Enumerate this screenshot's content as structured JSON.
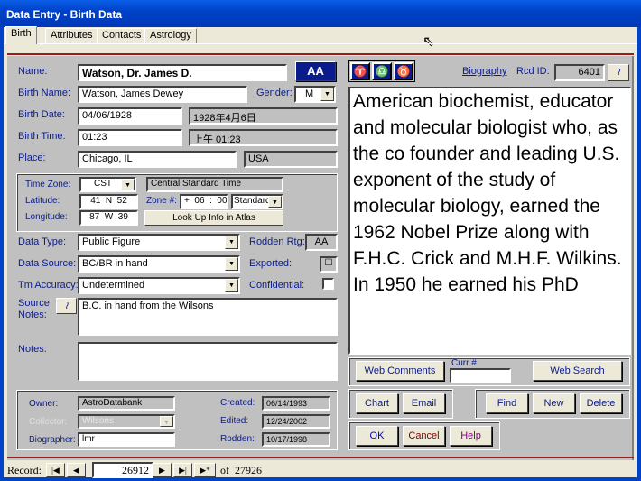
{
  "window": {
    "title": "Data Entry - Birth Data"
  },
  "tabs": [
    {
      "label": "Birth"
    },
    {
      "label": "Attributes"
    },
    {
      "label": "Contacts"
    },
    {
      "label": "Astrology"
    }
  ],
  "birth": {
    "name_label": "Name:",
    "name": "Watson, Dr. James D.",
    "aa_button": "AA",
    "birth_name_label": "Birth Name:",
    "birth_name": "Watson, James Dewey",
    "gender_label": "Gender:",
    "gender": "M",
    "birth_date_label": "Birth Date:",
    "birth_date": "04/06/1928",
    "birth_date_local": "1928年4月6日",
    "birth_time_label": "Birth Time:",
    "birth_time": "01:23",
    "birth_time_local": "上午 01:23",
    "place_label": "Place:",
    "place": "Chicago, IL",
    "country": "USA",
    "time_zone_label": "Time Zone:",
    "time_zone": "CST",
    "time_zone_name": "Central Standard Time",
    "latitude_label": "Latitude:",
    "latitude": "41  N  52",
    "zone_label": "Zone #:",
    "zone": "+  06  :  00",
    "zone_type": "Standard",
    "longitude_label": "Longitude:",
    "longitude": "87  W  39",
    "lookup_button": "Look Up Info in Atlas",
    "data_type_label": "Data Type:",
    "data_type": "Public Figure",
    "rodden_label": "Rodden Rtg:",
    "rodden": "AA",
    "data_source_label": "Data Source:",
    "data_source": "BC/BR in hand",
    "exported_label": "Exported:",
    "tm_accuracy_label": "Tm Accuracy:",
    "tm_accuracy": "Undetermined",
    "confidential_label": "Confidential:",
    "source_notes_label1": "Source",
    "source_notes_label2": "Notes:",
    "source_notes": "B.C. in hand from the Wilsons",
    "notes_label": "Notes:",
    "notes": "",
    "owner_label": "Owner:",
    "owner": "AstroDatabank",
    "collector_label": "Collector:",
    "collector": "Wilsons",
    "biographer_label": "Biographer:",
    "biographer": "lmr",
    "created_label": "Created:",
    "created": "06/14/1993",
    "edited_label": "Edited:",
    "edited": "12/24/2002",
    "rodden_date_label": "Rodden:",
    "rodden_date": "10/17/1998"
  },
  "right": {
    "symbols": [
      "♈",
      "♎",
      "♉"
    ],
    "biography_label": "Biography",
    "rcd_id_label": "Rcd ID:",
    "rcd_id": "6401",
    "biography": "American biochemist, educator and molecular biologist who, as the co founder and leading U.S. exponent of the study of molecular biology, earned the 1962 Nobel Prize along with F.H.C. Crick and M.H.F. Wilkins.  In 1950 he earned his PhD",
    "web_comments": "Web Comments",
    "curr_label": "Curr #",
    "curr": "",
    "web_search": "Web Search",
    "chart": "Chart",
    "email": "Email",
    "find": "Find",
    "new": "New",
    "delete": "Delete",
    "ok": "OK",
    "cancel": "Cancel",
    "help": "Help"
  },
  "record": {
    "label": "Record:",
    "current": "26912",
    "of_label": "of",
    "total": "27926"
  },
  "colors": {
    "title_bar": "#0042c8",
    "label": "#0a1c8c",
    "accent_line": "#9c1b1b",
    "cancel": "#800000",
    "help": "#800080"
  }
}
